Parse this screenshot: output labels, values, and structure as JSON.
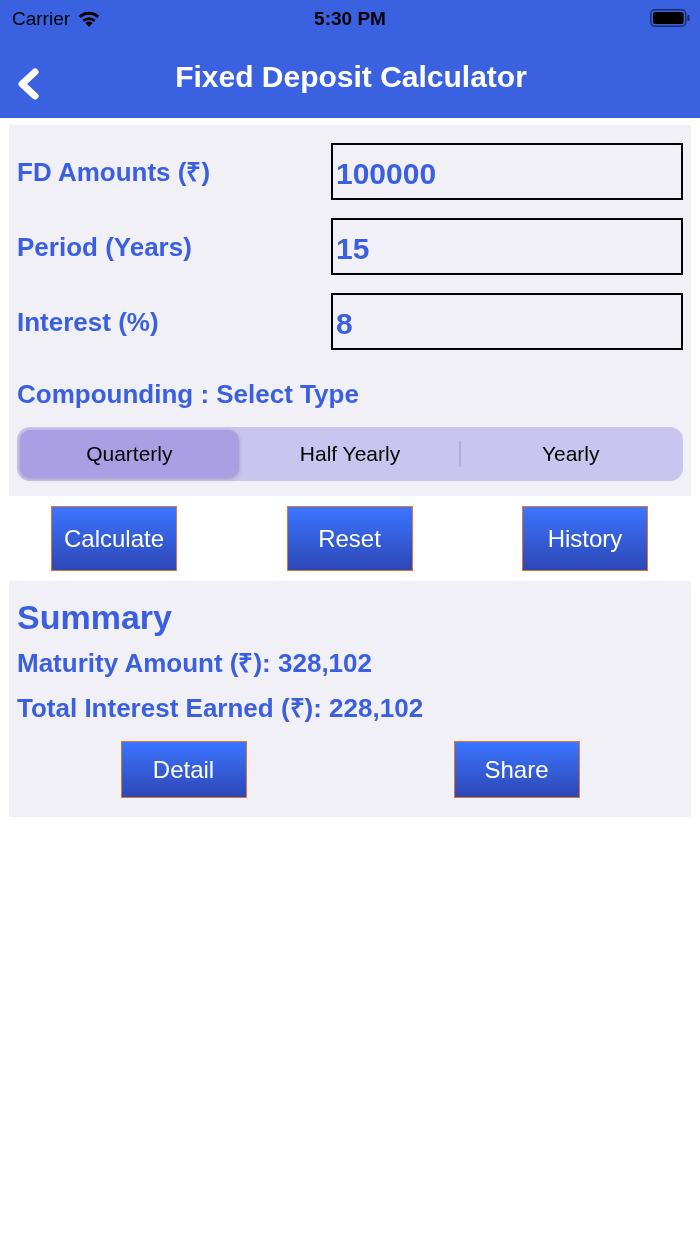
{
  "status_bar": {
    "carrier": "Carrier",
    "time": "5:30 PM"
  },
  "nav_bar": {
    "title": "Fixed Deposit Calculator"
  },
  "form": {
    "fields": [
      {
        "label": "FD Amounts (₹)",
        "value": "100000"
      },
      {
        "label": "Period (Years)",
        "value": "15"
      },
      {
        "label": "Interest (%)",
        "value": "8"
      }
    ],
    "compounding": {
      "label": "Compounding : Select Type",
      "options": [
        {
          "label": "Quarterly",
          "selected": true
        },
        {
          "label": "Half Yearly",
          "selected": false
        },
        {
          "label": "Yearly",
          "selected": false
        }
      ]
    }
  },
  "actions": [
    "Calculate",
    "Reset",
    "History"
  ],
  "summary": {
    "title": "Summary",
    "lines": [
      "Maturity Amount (₹): 328,102",
      "Total Interest Earned (₹): 228,102"
    ],
    "actions": [
      "Detail",
      "Share"
    ]
  }
}
